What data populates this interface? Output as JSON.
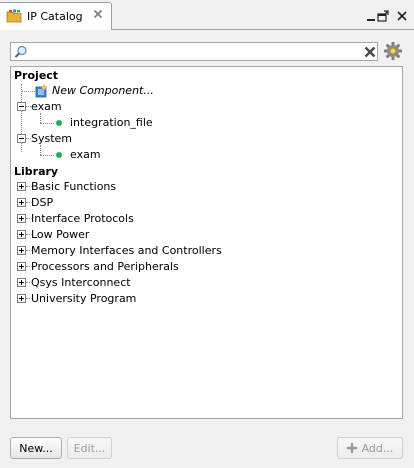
{
  "tab": {
    "title": "IP Catalog"
  },
  "search": {
    "value": "",
    "placeholder": ""
  },
  "tree": {
    "project_header": "Project",
    "new_component": "New Component...",
    "exam_node": "exam",
    "integration_file": "integration_file",
    "system_node": "System",
    "system_child": "exam",
    "library_header": "Library",
    "library_items": [
      "Basic Functions",
      "DSP",
      "Interface Protocols",
      "Low Power",
      "Memory Interfaces and Controllers",
      "Processors and Peripherals",
      "Qsys Interconnect",
      "University Program"
    ]
  },
  "buttons": {
    "new": "New...",
    "edit": "Edit...",
    "add": "Add..."
  },
  "colors": {
    "status_dot": "#22b14c",
    "new_component_icon": "#3a82d6",
    "folder_icon": "#e8b23a"
  }
}
